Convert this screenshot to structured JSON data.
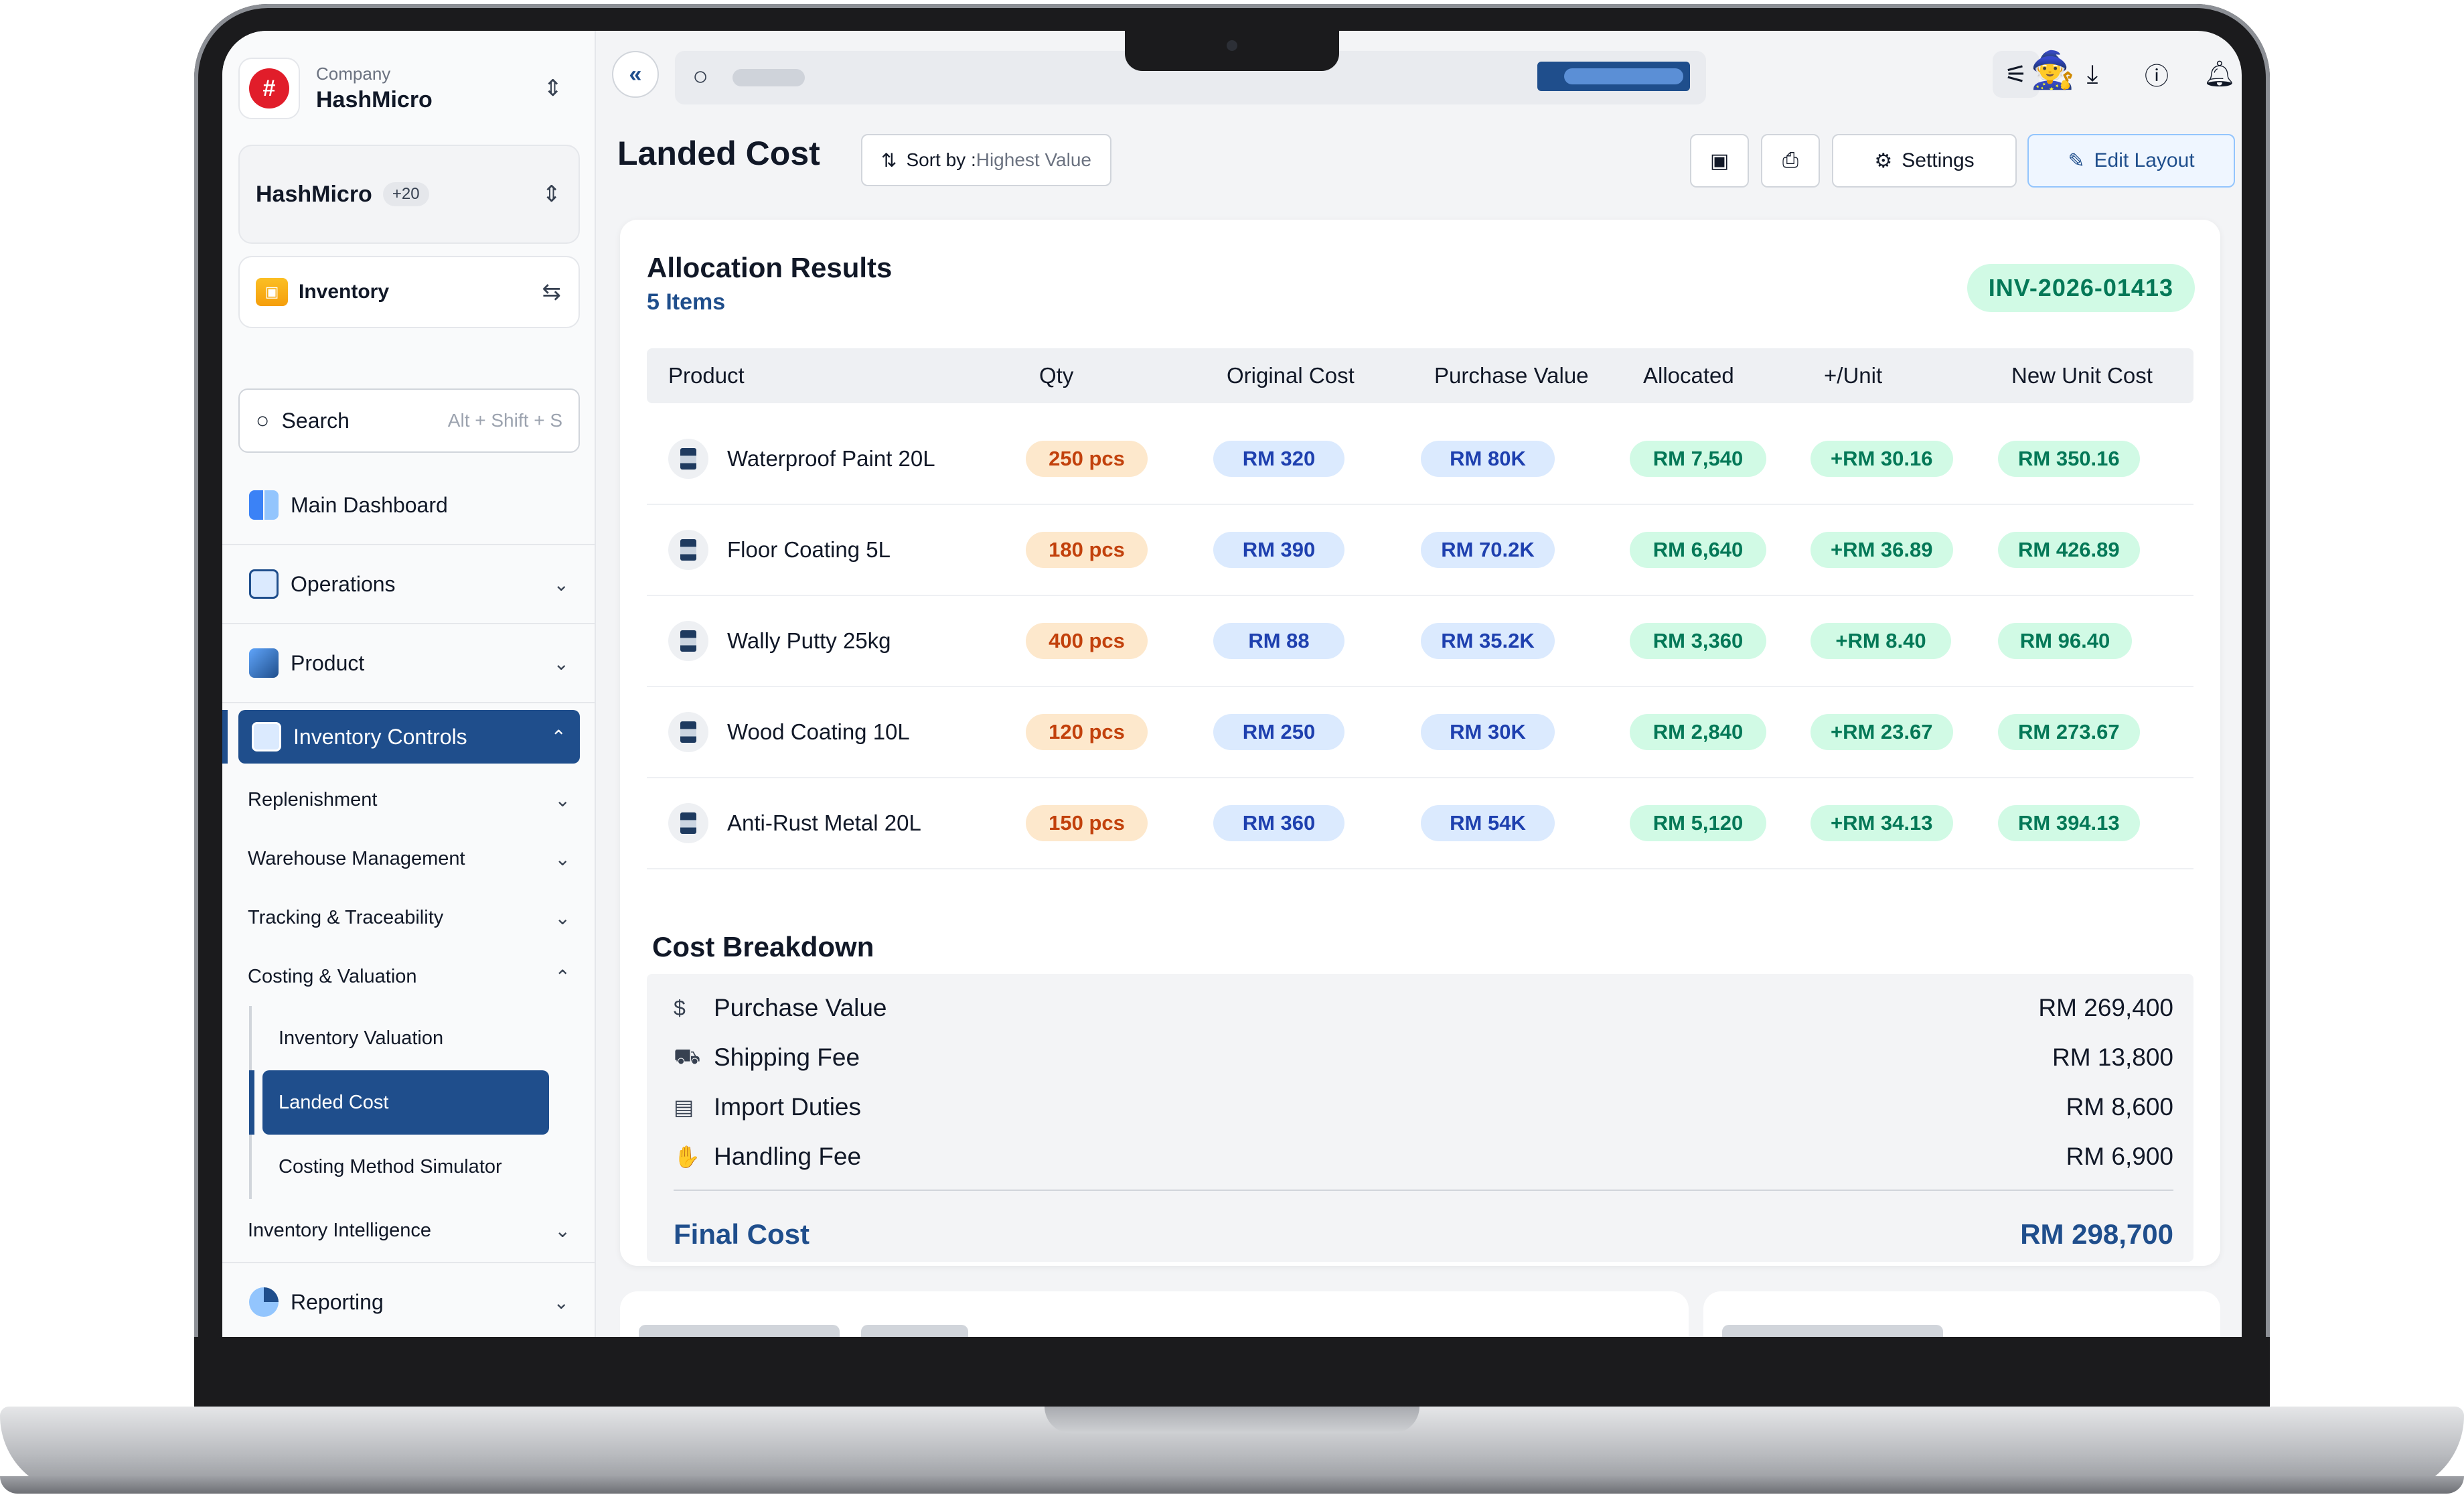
{
  "company": {
    "label": "Company",
    "name": "HashMicro",
    "logo_text": "#"
  },
  "workspace": {
    "name": "HashMicro",
    "count": "+20"
  },
  "module": {
    "name": "Inventory"
  },
  "sidebar_search": {
    "label": "Search",
    "shortcut": "Alt + Shift + S"
  },
  "nav": {
    "main_dashboard": "Main Dashboard",
    "operations": "Operations",
    "product": "Product",
    "inventory_controls": "Inventory Controls",
    "replenishment": "Replenishment",
    "warehouse_management": "Warehouse Management",
    "tracking": "Tracking & Traceability",
    "costing": "Costing & Valuation",
    "sub": [
      "Inventory Valuation",
      "Landed Cost",
      "Costing Method Simulator"
    ],
    "inventory_intelligence": "Inventory Intelligence",
    "reporting": "Reporting"
  },
  "page": {
    "title": "Landed Cost",
    "sort_label": "Sort by : ",
    "sort_value": "Highest Value",
    "settings": "Settings",
    "edit_layout": "Edit Layout"
  },
  "allocation": {
    "title": "Allocation Results",
    "count": "5 Items",
    "invoice": "INV-2026-01413",
    "headers": [
      "Product",
      "Qty",
      "Original Cost",
      "Purchase Value",
      "Allocated",
      "+/Unit",
      "New Unit Cost"
    ],
    "rows": [
      {
        "product": "Waterproof Paint 20L",
        "qty": "250 pcs",
        "original": "RM 320",
        "purchase": "RM 80K",
        "allocated": "RM 7,540",
        "unit": "+RM 30.16",
        "new": "RM 350.16"
      },
      {
        "product": "Floor Coating 5L",
        "qty": "180 pcs",
        "original": "RM 390",
        "purchase": "RM 70.2K",
        "allocated": "RM 6,640",
        "unit": "+RM 36.89",
        "new": "RM 426.89"
      },
      {
        "product": "Wally Putty 25kg",
        "qty": "400 pcs",
        "original": "RM 88",
        "purchase": "RM 35.2K",
        "allocated": "RM 3,360",
        "unit": "+RM 8.40",
        "new": "RM 96.40"
      },
      {
        "product": "Wood Coating 10L",
        "qty": "120 pcs",
        "original": "RM 250",
        "purchase": "RM 30K",
        "allocated": "RM 2,840",
        "unit": "+RM 23.67",
        "new": "RM 273.67"
      },
      {
        "product": "Anti-Rust Metal 20L",
        "qty": "150 pcs",
        "original": "RM 360",
        "purchase": "RM 54K",
        "allocated": "RM 5,120",
        "unit": "+RM 34.13",
        "new": "RM 394.13"
      }
    ]
  },
  "breakdown": {
    "title": "Cost Breakdown",
    "items": [
      {
        "label": "Purchase Value",
        "value": "RM 269,400",
        "icon": "dollar-circle-icon"
      },
      {
        "label": "Shipping Fee",
        "value": "RM 13,800",
        "icon": "truck-icon"
      },
      {
        "label": "Import Duties",
        "value": "RM 8,600",
        "icon": "document-icon"
      },
      {
        "label": "Handling Fee",
        "value": "RM 6,900",
        "icon": "hand-box-icon"
      }
    ],
    "final_label": "Final Cost",
    "final_value": "RM 298,700"
  },
  "colors": {
    "primary": "#1f4e8c",
    "green": "#047857",
    "orange": "#c2410c",
    "blue": "#1e40af"
  }
}
